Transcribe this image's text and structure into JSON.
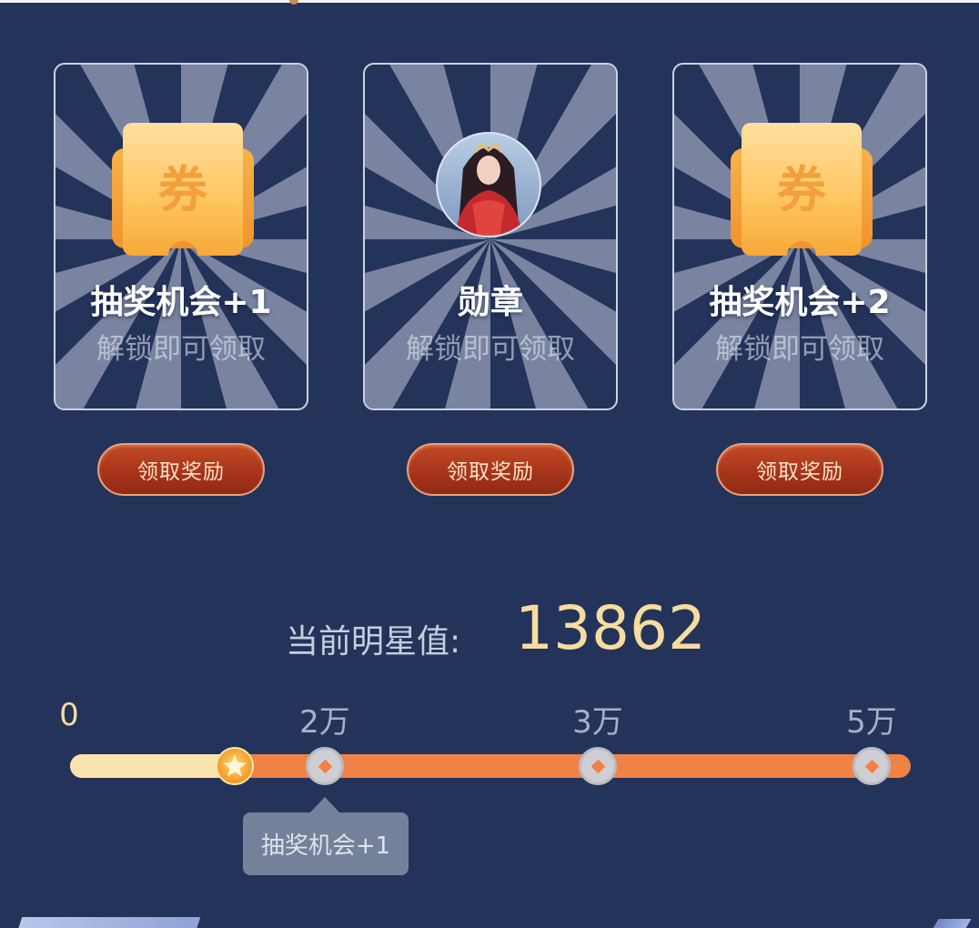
{
  "rewards": [
    {
      "title": "抽奖机会+1",
      "subtitle": "解锁即可领取",
      "icon": "ticket-icon",
      "icon_text": "券",
      "button_label": "领取奖励"
    },
    {
      "title": "勋章",
      "subtitle": "解锁即可领取",
      "icon": "badge-avatar",
      "icon_text": "",
      "button_label": "领取奖励"
    },
    {
      "title": "抽奖机会+2",
      "subtitle": "解锁即可领取",
      "icon": "ticket-icon",
      "icon_text": "券",
      "button_label": "领取奖励"
    }
  ],
  "star": {
    "label": "当前明星值:",
    "value": "13862"
  },
  "progress": {
    "current_value": 13862,
    "stops": [
      0,
      20000,
      30000,
      50000
    ],
    "ticks": [
      "0",
      "2万",
      "3万",
      "5万"
    ],
    "filled_ratio": 0.196
  },
  "tooltip": {
    "text": "抽奖机会+1"
  },
  "colors": {
    "background": "#24335a",
    "track": "#ef8244",
    "track_fill": "#fae3ad",
    "value_gold": "#f6dca0",
    "button_red": "#b23b1d"
  }
}
